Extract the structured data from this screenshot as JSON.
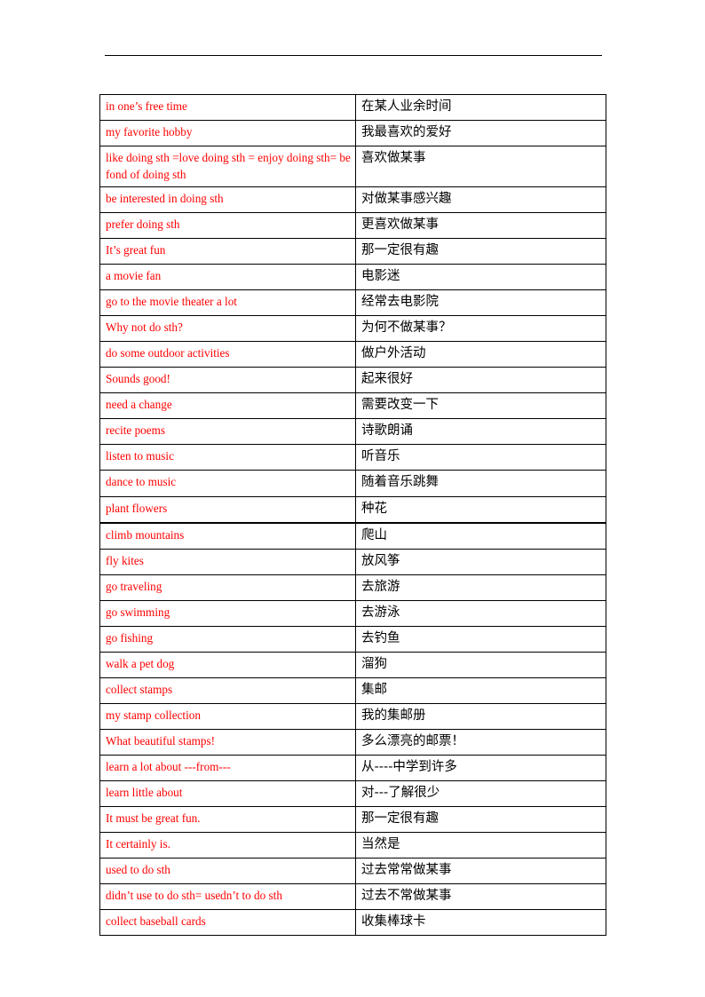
{
  "document": {
    "title": "English-Chinese Phrase Vocabulary Table",
    "header_rule": true,
    "text_color_english": "#FF0000",
    "text_color_chinese": "#000000",
    "border_color": "#000000"
  },
  "table": {
    "columns": [
      "english",
      "chinese"
    ],
    "rows": [
      {
        "english": "in one’s free time",
        "chinese": "在某人业余时间"
      },
      {
        "english": "my favorite hobby",
        "chinese": "我最喜欢的爱好"
      },
      {
        "english": "like doing sth =love doing sth = enjoy doing sth= be fond of doing sth",
        "chinese": "喜欢做某事",
        "tall": true
      },
      {
        "english": "be interested in doing sth",
        "chinese": "对做某事感兴趣"
      },
      {
        "english": "prefer doing sth",
        "chinese": "更喜欢做某事"
      },
      {
        "english": "It’s great fun",
        "chinese": "那一定很有趣"
      },
      {
        "english": "a movie fan",
        "chinese": "电影迷"
      },
      {
        "english": "go to the movie theater a lot",
        "chinese": "经常去电影院"
      },
      {
        "english": "Why not do sth?",
        "chinese": "为何不做某事？"
      },
      {
        "english": "do some outdoor activities",
        "chinese": "做户外活动"
      },
      {
        "english": "Sounds good!",
        "chinese": "起来很好"
      },
      {
        "english": "need a change",
        "chinese": "需要改变一下"
      },
      {
        "english": "recite poems",
        "chinese": "诗歌朗诵"
      },
      {
        "english": "listen to music",
        "chinese": "听音乐"
      },
      {
        "english": "dance to music",
        "chinese": "随着音乐跳舞"
      },
      {
        "english": "plant flowers",
        "chinese": "种花",
        "thick_below": true
      },
      {
        "english": "climb mountains",
        "chinese": "爬山"
      },
      {
        "english": "fly kites",
        "chinese": "放风筝"
      },
      {
        "english": "go traveling",
        "chinese": "去旅游"
      },
      {
        "english": "go swimming",
        "chinese": "去游泳"
      },
      {
        "english": "go fishing",
        "chinese": "去钓鱼"
      },
      {
        "english": "walk a pet dog",
        "chinese": "溜狗"
      },
      {
        "english": "collect stamps",
        "chinese": "集邮"
      },
      {
        "english": "my stamp collection",
        "chinese": "我的集邮册"
      },
      {
        "english": "What beautiful stamps!",
        "chinese": "多么漂亮的邮票！"
      },
      {
        "english": "learn a lot about ---from---",
        "chinese": "从----中学到许多"
      },
      {
        "english": "learn little about",
        "chinese": "对---了解很少"
      },
      {
        "english": "It must be great fun.",
        "chinese": "那一定很有趣"
      },
      {
        "english": "It certainly is.",
        "chinese": "当然是"
      },
      {
        "english": "used to do sth",
        "chinese": "过去常常做某事"
      },
      {
        "english": "didn’t use to do sth= usedn’t to do sth",
        "chinese": "过去不常做某事"
      },
      {
        "english": "collect baseball cards",
        "chinese": "收集棒球卡"
      }
    ]
  }
}
